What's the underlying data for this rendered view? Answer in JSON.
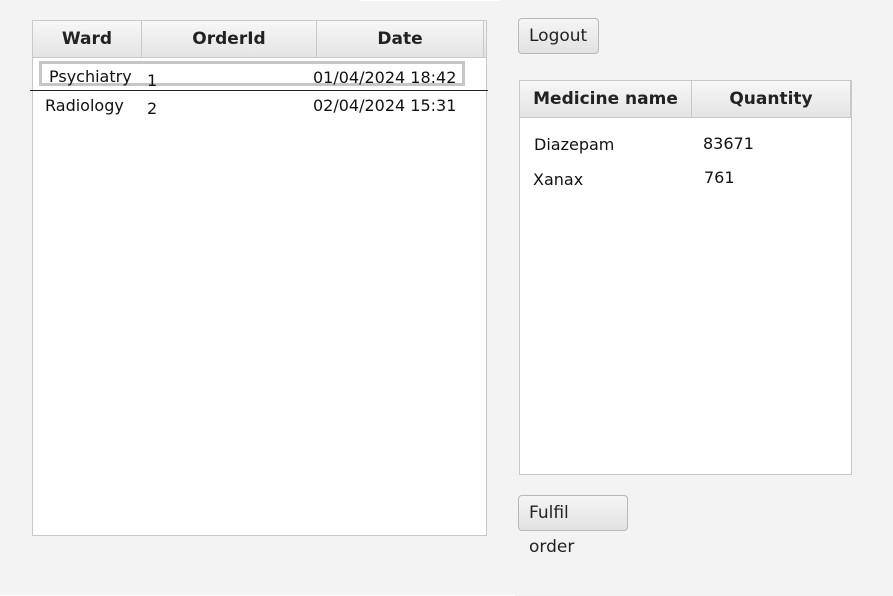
{
  "orders_table": {
    "columns": [
      "Ward",
      "OrderId",
      "Date"
    ],
    "rows": [
      {
        "ward": "Psychiatry",
        "order_id": "1",
        "date": "01/04/2024 18:42"
      },
      {
        "ward": "Radiology",
        "order_id": "2",
        "date": "02/04/2024 15:31"
      }
    ]
  },
  "medicine_table": {
    "columns": [
      "Medicine name",
      "Quantity"
    ],
    "rows": [
      {
        "name": "Diazepam",
        "quantity": "83671"
      },
      {
        "name": "Xanax",
        "quantity": "761"
      }
    ]
  },
  "buttons": {
    "logout": "Logout",
    "fulfil_order": "Fulfil order"
  }
}
